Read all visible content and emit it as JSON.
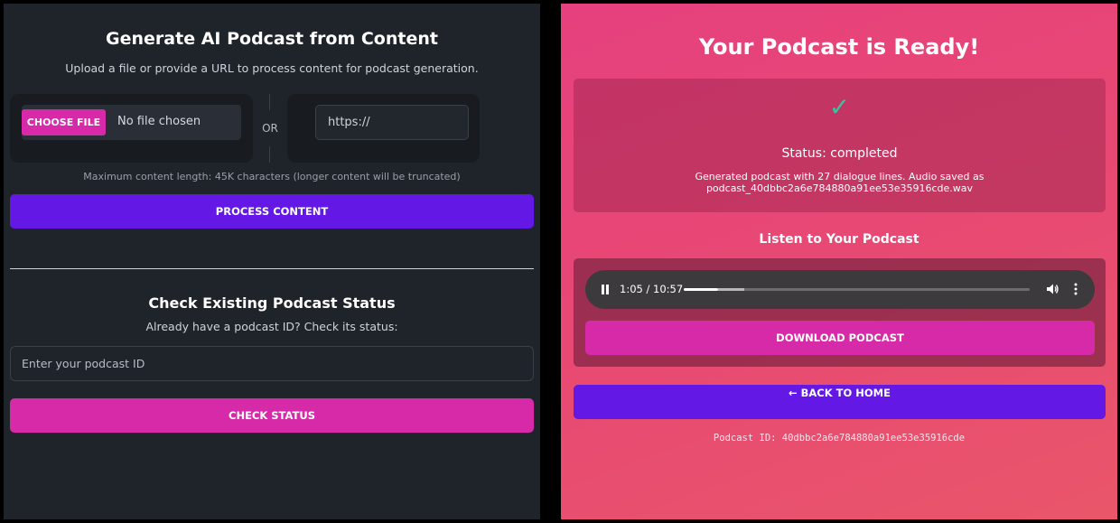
{
  "generate": {
    "title": "Generate AI Podcast from Content",
    "subtitle": "Upload a file or provide a URL to process content for podcast generation.",
    "file_button_label": "CHOOSE FILE",
    "file_status": "No file chosen",
    "or_label": "OR",
    "url_placeholder": "https://",
    "max_length_note": "Maximum content length: 45K characters (longer content will be truncated)",
    "process_button_label": "PROCESS CONTENT"
  },
  "check": {
    "title": "Check Existing Podcast Status",
    "subtitle": "Already have a podcast ID? Check its status:",
    "id_placeholder": "Enter your podcast ID",
    "check_button_label": "CHECK STATUS"
  },
  "result": {
    "title": "Your Podcast is Ready!",
    "check_icon": "✓",
    "status_text": "Status: completed",
    "status_message": "Generated podcast with 27 dialogue lines. Audio saved as podcast_40dbbc2a6e784880a91ee53e35916cde.wav",
    "listen_title": "Listen to Your Podcast",
    "download_button_label": "DOWNLOAD PODCAST",
    "back_button_label": "← BACK TO HOME",
    "podcast_id_text": "Podcast ID: 40dbbc2a6e784880a91ee53e35916cde"
  },
  "player": {
    "time_display": "1:05 / 10:57",
    "played_fraction": 0.099,
    "buffered_fraction": 0.175,
    "playing": true,
    "icons": [
      "pause-icon",
      "volume-icon",
      "more-options-icon"
    ]
  },
  "colors": {
    "left_background": "#1f232a",
    "accent_pink": "#d62aa9",
    "accent_purple": "#6318e6",
    "success_green": "#3dc0a0",
    "right_gradient_start": "#e6407e",
    "right_gradient_end": "#e9566a"
  }
}
